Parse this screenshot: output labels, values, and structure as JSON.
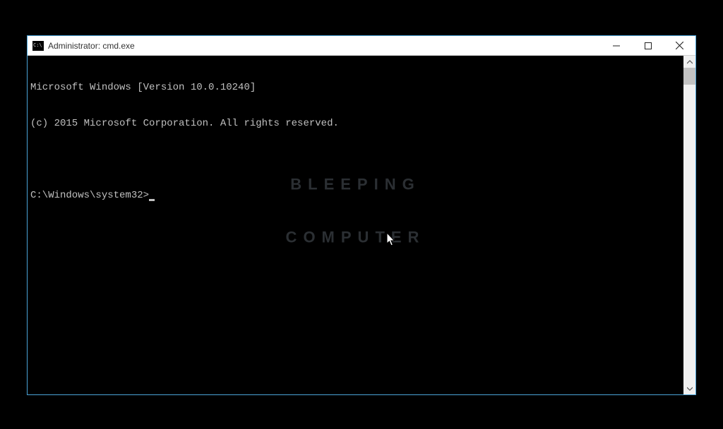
{
  "window": {
    "title": "Administrator: cmd.exe"
  },
  "terminal": {
    "line1": "Microsoft Windows [Version 10.0.10240]",
    "line2": "(c) 2015 Microsoft Corporation. All rights reserved.",
    "prompt": "C:\\Windows\\system32>"
  },
  "watermark": {
    "line1": "BLEEPING",
    "line2": "COMPUTER"
  }
}
